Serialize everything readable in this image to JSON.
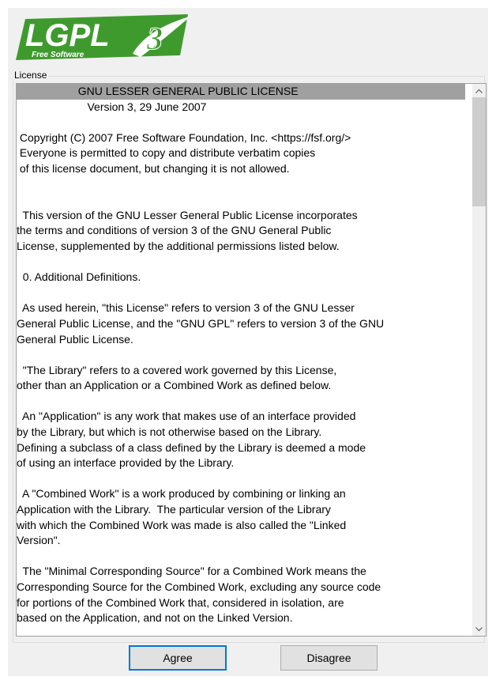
{
  "logo": {
    "text": "LGPL",
    "version": "3",
    "subtitle": "Free Software",
    "colors": {
      "green": "#3f9a2e",
      "white": "#ffffff"
    }
  },
  "license_group": {
    "label": "License"
  },
  "license_text": {
    "lines": [
      "                    GNU LESSER GENERAL PUBLIC LICENSE",
      "                       Version 3, 29 June 2007",
      "",
      " Copyright (C) 2007 Free Software Foundation, Inc. <https://fsf.org/>",
      " Everyone is permitted to copy and distribute verbatim copies",
      " of this license document, but changing it is not allowed.",
      "",
      "",
      "  This version of the GNU Lesser General Public License incorporates",
      "the terms and conditions of version 3 of the GNU General Public",
      "License, supplemented by the additional permissions listed below.",
      "",
      "  0. Additional Definitions.",
      "",
      "  As used herein, \"this License\" refers to version 3 of the GNU Lesser",
      "General Public License, and the \"GNU GPL\" refers to version 3 of the GNU",
      "General Public License.",
      "",
      "  \"The Library\" refers to a covered work governed by this License,",
      "other than an Application or a Combined Work as defined below.",
      "",
      "  An \"Application\" is any work that makes use of an interface provided",
      "by the Library, but which is not otherwise based on the Library.",
      "Defining a subclass of a class defined by the Library is deemed a mode",
      "of using an interface provided by the Library.",
      "",
      "  A \"Combined Work\" is a work produced by combining or linking an",
      "Application with the Library.  The particular version of the Library",
      "with which the Combined Work was made is also called the \"Linked",
      "Version\".",
      "",
      "  The \"Minimal Corresponding Source\" for a Combined Work means the",
      "Corresponding Source for the Combined Work, excluding any source code",
      "for portions of the Combined Work that, considered in isolation, are",
      "based on the Application, and not on the Linked Version."
    ],
    "scroll_position": 0.0
  },
  "scrollbar": {
    "up_icon": "chevron-up-icon",
    "down_icon": "chevron-down-icon"
  },
  "buttons": {
    "agree_label": "Agree",
    "disagree_label": "Disagree"
  }
}
